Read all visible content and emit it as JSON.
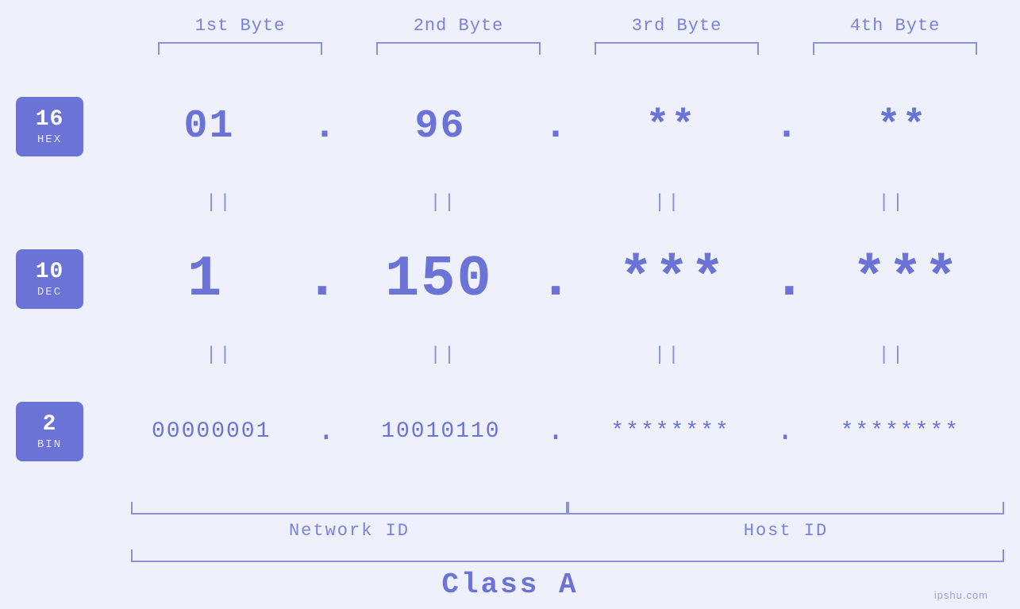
{
  "byte_labels": [
    "1st Byte",
    "2nd Byte",
    "3rd Byte",
    "4th Byte"
  ],
  "badges": [
    {
      "num": "16",
      "label": "HEX"
    },
    {
      "num": "10",
      "label": "DEC"
    },
    {
      "num": "2",
      "label": "BIN"
    }
  ],
  "rows": [
    {
      "values": [
        "01",
        "96",
        "**",
        "**"
      ],
      "separators": [
        ".",
        ".",
        "."
      ],
      "size": "medium"
    },
    {
      "values": [
        "1",
        "150",
        "***",
        "***"
      ],
      "separators": [
        ".",
        ".",
        "."
      ],
      "size": "large"
    },
    {
      "values": [
        "00000001",
        "10010110",
        "********",
        "********"
      ],
      "separators": [
        ".",
        ".",
        "."
      ],
      "size": "small"
    }
  ],
  "network_id_label": "Network ID",
  "host_id_label": "Host ID",
  "class_label": "Class A",
  "watermark": "ipshu.com"
}
